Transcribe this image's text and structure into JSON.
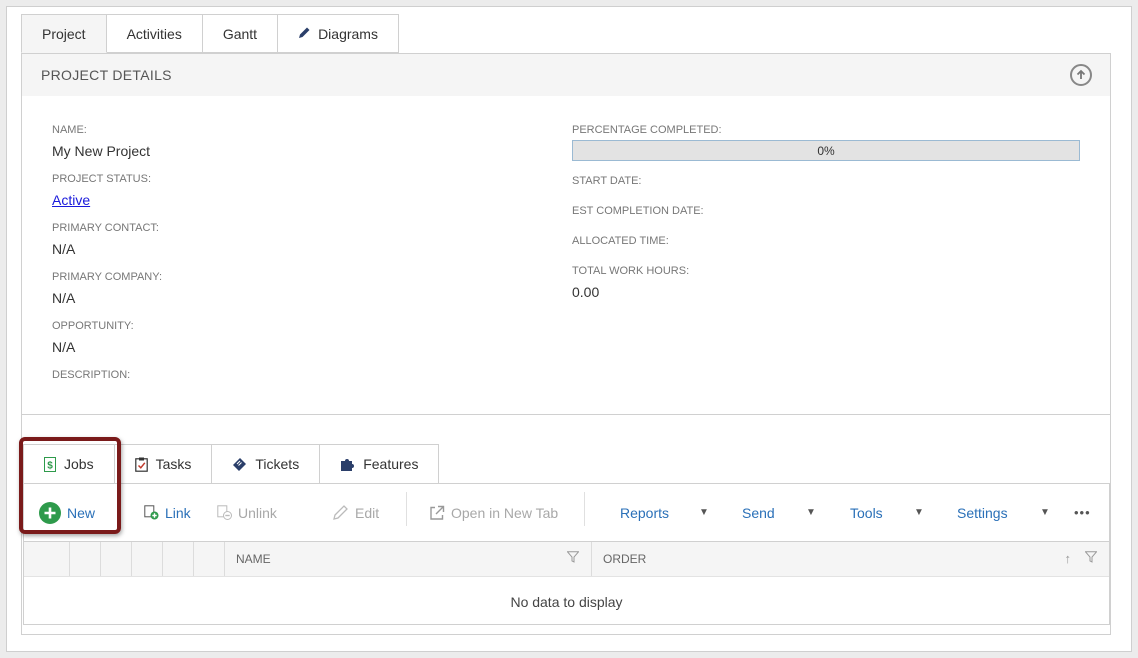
{
  "top_tabs": [
    {
      "label": "Project"
    },
    {
      "label": "Activities"
    },
    {
      "label": "Gantt"
    },
    {
      "label": "Diagrams"
    }
  ],
  "details": {
    "title": "PROJECT DETAILS",
    "left_fields": {
      "name_label": "NAME:",
      "name_value": "My New Project",
      "status_label": "PROJECT STATUS:",
      "status_value": "Active",
      "contact_label": "PRIMARY CONTACT:",
      "contact_value": "N/A",
      "company_label": "PRIMARY COMPANY:",
      "company_value": "N/A",
      "opportunity_label": "OPPORTUNITY:",
      "opportunity_value": "N/A",
      "description_label": "DESCRIPTION:"
    },
    "right_fields": {
      "percentage_label": "PERCENTAGE COMPLETED:",
      "percentage_value": "0%",
      "start_label": "START DATE:",
      "est_completion_label": "EST COMPLETION DATE:",
      "allocated_label": "ALLOCATED TIME:",
      "total_hours_label": "TOTAL WORK HOURS:",
      "total_hours_value": "0.00"
    }
  },
  "sub_tabs": [
    {
      "label": "Jobs"
    },
    {
      "label": "Tasks"
    },
    {
      "label": "Tickets"
    },
    {
      "label": "Features"
    }
  ],
  "toolbar": {
    "new_label": "New",
    "link_label": "Link",
    "unlink_label": "Unlink",
    "edit_label": "Edit",
    "open_new_tab_label": "Open in New Tab",
    "reports_label": "Reports",
    "send_label": "Send",
    "tools_label": "Tools",
    "settings_label": "Settings",
    "more_label": "•••"
  },
  "grid": {
    "columns": [
      "NAME",
      "ORDER"
    ],
    "empty_text": "No data to display"
  },
  "colors": {
    "link_blue": "#2a70b8",
    "new_green": "#2e9a4b",
    "highlight": "#7a1a1a"
  }
}
